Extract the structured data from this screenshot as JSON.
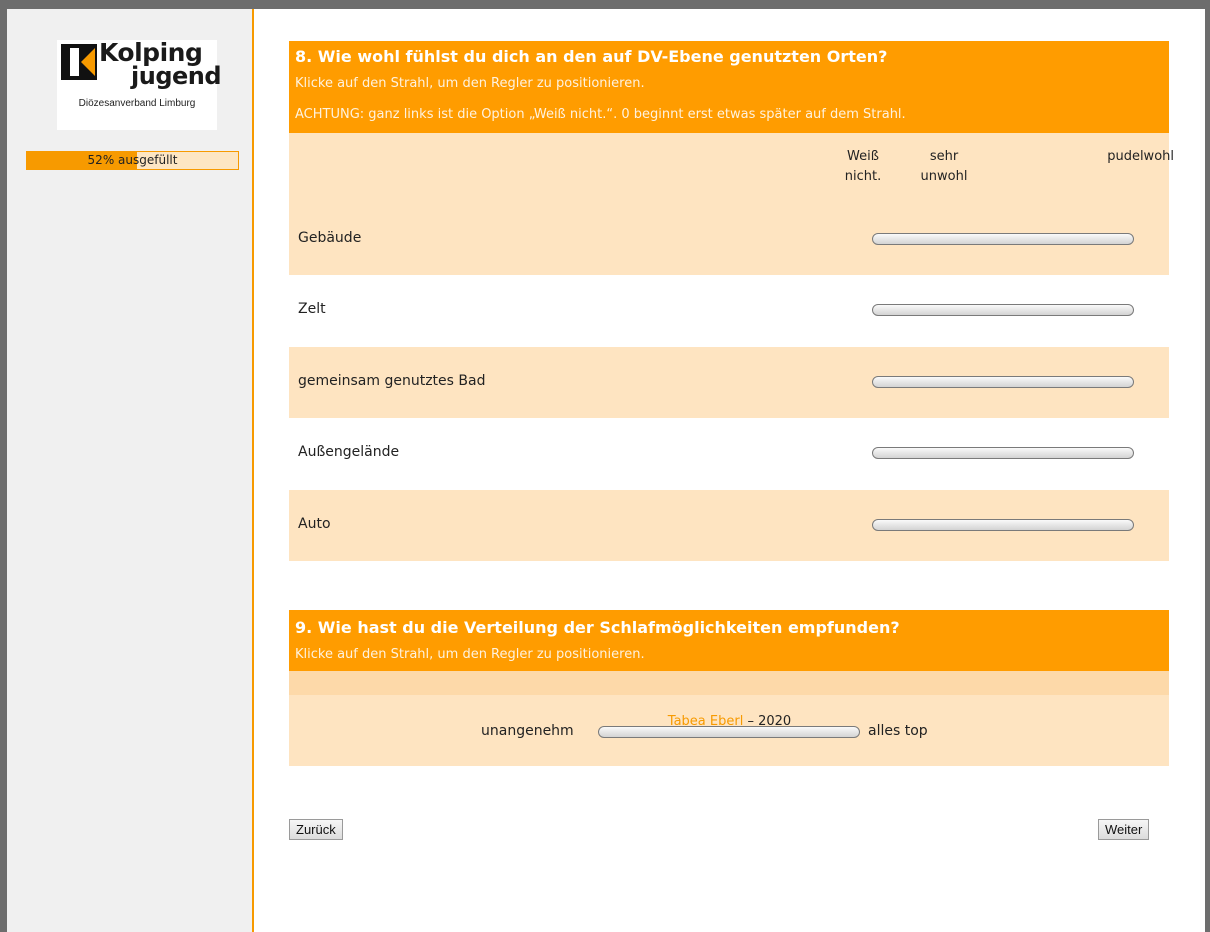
{
  "logo": {
    "line1": "Kolping",
    "line2": "jugend",
    "subline": "Diözesanverband Limburg"
  },
  "progress": {
    "percent": 52,
    "label": "52% ausgefüllt"
  },
  "q8": {
    "title": "8. Wie wohl fühlst du dich an den auf DV-Ebene genutzten Orten?",
    "hint1": "Klicke auf den Strahl, um den Regler zu positionieren.",
    "hint2": "ACHTUNG: ganz links ist die Option „Weiß nicht.“. 0 beginnt erst etwas später auf dem Strahl.",
    "scale": {
      "dont_know": "Weiß nicht.",
      "low": "sehr unwohl",
      "high": "pudelwohl"
    },
    "rows": [
      {
        "label": "Gebäude"
      },
      {
        "label": "Zelt"
      },
      {
        "label": "gemeinsam genutztes Bad"
      },
      {
        "label": "Außengelände"
      },
      {
        "label": "Auto"
      }
    ]
  },
  "q9": {
    "title": "9. Wie hast du die Verteilung der Schlafmöglichkeiten empfunden?",
    "hint": "Klicke auf den Strahl, um den Regler zu positionieren.",
    "left_label": "unangenehm",
    "right_label": "alles top"
  },
  "buttons": {
    "back": "Zurück",
    "next": "Weiter"
  },
  "footer": {
    "author": "Tabea Eberl",
    "sep": " – ",
    "year": "2020"
  },
  "colors": {
    "accent": "#ff9c00",
    "row_alt": "#fee4c1",
    "sidebar": "#f0f0f0"
  }
}
